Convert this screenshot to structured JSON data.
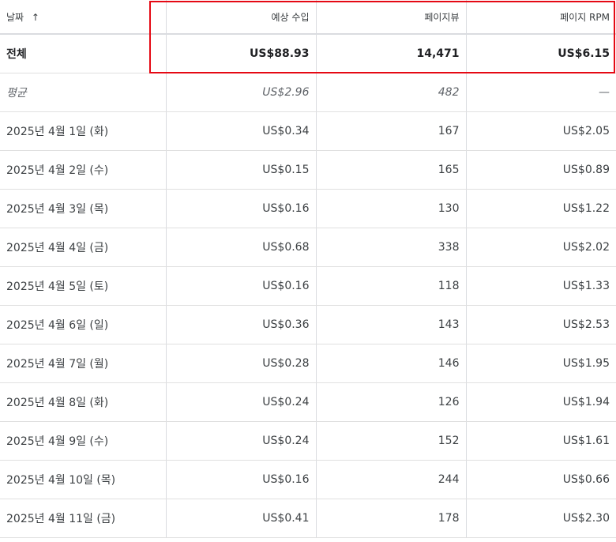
{
  "header": {
    "date_label": "날짜",
    "sort_icon": "arrow-up-icon",
    "sort_glyph": "↑",
    "revenue_label": "예상 수입",
    "pageviews_label": "페이지뷰",
    "rpm_label": "페이지 RPM"
  },
  "total": {
    "label": "전체",
    "revenue": "US$88.93",
    "pageviews": "14,471",
    "rpm": "US$6.15"
  },
  "average": {
    "label": "평균",
    "revenue": "US$2.96",
    "pageviews": "482",
    "rpm": "—"
  },
  "rows": [
    {
      "date": "2025년 4월 1일 (화)",
      "revenue": "US$0.34",
      "pageviews": "167",
      "rpm": "US$2.05"
    },
    {
      "date": "2025년 4월 2일 (수)",
      "revenue": "US$0.15",
      "pageviews": "165",
      "rpm": "US$0.89"
    },
    {
      "date": "2025년 4월 3일 (목)",
      "revenue": "US$0.16",
      "pageviews": "130",
      "rpm": "US$1.22"
    },
    {
      "date": "2025년 4월 4일 (금)",
      "revenue": "US$0.68",
      "pageviews": "338",
      "rpm": "US$2.02"
    },
    {
      "date": "2025년 4월 5일 (토)",
      "revenue": "US$0.16",
      "pageviews": "118",
      "rpm": "US$1.33"
    },
    {
      "date": "2025년 4월 6일 (일)",
      "revenue": "US$0.36",
      "pageviews": "143",
      "rpm": "US$2.53"
    },
    {
      "date": "2025년 4월 7일 (월)",
      "revenue": "US$0.28",
      "pageviews": "146",
      "rpm": "US$1.95"
    },
    {
      "date": "2025년 4월 8일 (화)",
      "revenue": "US$0.24",
      "pageviews": "126",
      "rpm": "US$1.94"
    },
    {
      "date": "2025년 4월 9일 (수)",
      "revenue": "US$0.24",
      "pageviews": "152",
      "rpm": "US$1.61"
    },
    {
      "date": "2025년 4월 10일 (목)",
      "revenue": "US$0.16",
      "pageviews": "244",
      "rpm": "US$0.66"
    },
    {
      "date": "2025년 4월 11일 (금)",
      "revenue": "US$0.41",
      "pageviews": "178",
      "rpm": "US$2.30"
    }
  ],
  "colors": {
    "highlight": "#e50914",
    "border": "#dadce0",
    "text": "#3c4043"
  }
}
